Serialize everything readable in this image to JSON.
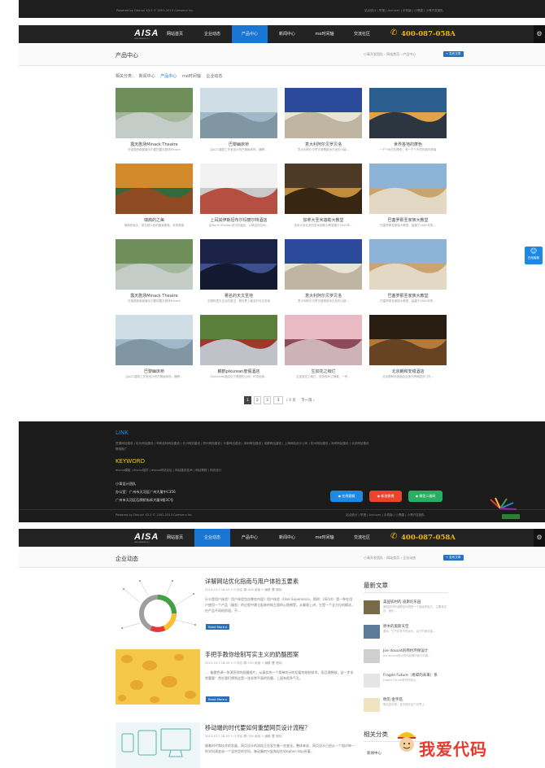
{
  "top_footer": {
    "copyright": "Powered by Discuz! X3.2 © 2001-2013 Comsenz Inc.",
    "links": "站点统计 | 举报 | Archiver | 手机版 | 小黑屋 | 小青开发团队"
  },
  "brand": {
    "logo": "AISA",
    "tagline": "www.aisacms.cn"
  },
  "nav": {
    "items": [
      "网站首页",
      "企业动态",
      "产品中心",
      "新闻中心",
      "me时间轴",
      "交流社区"
    ],
    "phone": "400-087-058A"
  },
  "products_page": {
    "title": "产品中心",
    "breadcrumb": "小青开发团队 › 网站首页 › 产品中心",
    "publish_button": "+ 发布文章",
    "categories_label": "相关分类：",
    "categories": [
      "新闻中心",
      "产品中心",
      "me时间轴",
      "企业动态"
    ],
    "active_category": "产品中心",
    "items": [
      {
        "title": "露天剧场Minack Theatre",
        "desc": "在英国西南部康沃尔郡的露天剧场Minack"
      },
      {
        "title": "巴黎幽床桥",
        "desc": "由AZC建筑工作室设计的巴黎幽床桥，横跨…"
      },
      {
        "title": "意大利阿尔贝罗贝洛",
        "desc": "意大利阿尔贝罗贝洛是欧洲古老的小镇…"
      },
      {
        "title": "世界各地的摩色",
        "desc": "一千个地方的摩色，有一千个不同的城市故事"
      },
      {
        "title": "瑞典的之美",
        "desc": "瑞典的秋天，被五颜六色的植被覆盖，非常美丽"
      },
      {
        "title": "上耳其伊斯坦布尔玛丽尔特酒店",
        "desc": "由Norm Shelton设计的酒店，以简洁的空间…"
      },
      {
        "title": "加拿大圣米迦勒大教堂",
        "desc": "加拿大多伦多的圣米迦勒大教堂建于1845年…"
      },
      {
        "title": "巴塞罗那圣家族大教堂",
        "desc": "巴塞罗那圣家族大教堂，始建于1882年的…"
      },
      {
        "title": "露天剧场Minack Theatre",
        "desc": "在英国西南部康沃尔郡的露天剧场Minack"
      },
      {
        "title": "著名的天文圣地",
        "desc": "中国阿里天文台的星空，是世界上著名的天文圣地"
      },
      {
        "title": "意大利阿尔贝罗贝洛",
        "desc": "意大利阿尔贝罗贝洛是欧洲古老的小镇…"
      },
      {
        "title": "巴塞罗那圣家族大教堂",
        "desc": "巴塞罗那圣家族大教堂，始建于1882年的…"
      },
      {
        "title": "巴黎幽床桥",
        "desc": "由AZC建筑工作室设计的巴黎幽床桥，横跨…"
      },
      {
        "title": "麟鹤pikurean度假酒店",
        "desc": "Epikurean酒店位于美丽的山间，环境优美…"
      },
      {
        "title": "生如花之绚烂",
        "desc": "生如夏花之绚烂，死如秋叶之静美，一杯…"
      },
      {
        "title": "北京朗和安缦酒店",
        "desc": "北京颐和安缦酒店坐落于颐和园东门外…"
      }
    ],
    "pagination": {
      "pages": [
        "1",
        "2",
        "3"
      ],
      "current": "1",
      "jump": "/ 3 页",
      "next": "下一页 ›"
    }
  },
  "footer": {
    "link_title": "LINK",
    "links_row1": "资源网站建设 | 包头网站建设 | 呼和浩特网站建设 | 长沙网站建设 | 郑州网站建设 | 长春网站建设 | 深圳网站建设 | 成都网站建设 | 上海网站设计公司 | 杭州网站建设 | 深圳网站建设 | 北京网站建设",
    "links_row2": "联络推广",
    "keyword_title": "KEYWORD",
    "keywords": "discuz模板 | discuz插件 | discuz网站论坛 | 网站建设技术 | 网站教程 | 网页设计",
    "team": "小青设计团队",
    "address1": "办公室：广州市天河区广州大厦中C356",
    "address2": "广州市天河区石牌桥街禾大厦4楼3C号",
    "online": "在线客服",
    "weibo": "新浪微博",
    "wechat": "微信二维码",
    "copyright": "Powered by Discuz! X3.2 © 2001-2013 Comsenz Inc.",
    "bottom_links": "站点统计 | 举报 | Archiver | 手机版 | 小黑屋 | 小青开发团队"
  },
  "news_page": {
    "title": "企业动态",
    "breadcrumb": "小青开发团队 › 网站首页 › 企业动态",
    "publish_button": "+ 发布文章",
    "articles": [
      {
        "title": "详解网站优化指南与用户体验五要素",
        "meta": "2013-10-7 18:33  ✎ 0 评论  👁 428 阅读  ✎ 编辑  🗑 删除",
        "excerpt": "什么是用户体验？用户体验包含哪些内容？用户体验（User Experience，简称：UE/UX）是一种在用户使用一个产品（服务）的过程中建立起来的纯主观的心理感受。从美观上讲，它是一个全方位的概念，在产品不同的阶段，不…",
        "more": "Read More ▸"
      },
      {
        "title": "手把手教你绘制写实主义的奶酪图案",
        "meta": "2013-10-7 18:33  ✎ 0 评论  👁 219 阅读  ✎ 编辑  🗑 删除",
        "excerpt": "…. 能跟色调一张漂亮到的奶酪图片，从真实的一个简单的计的切爱的绘制技术。而且理想效，这一步非常重要！首先我们想到这是一张非常平面的奶酪，上面有很多气孔。",
        "more": "Read More ▸"
      },
      {
        "title": "移动端的时代要如何重塑网页设计流程？",
        "meta": "2013-10-7 18:33  ✎ 0 评论  👁 239 阅读  ✎ 编辑  🗑 删除",
        "excerpt": "随着时代和技术的发展，网页设计的流程正在发生着一些变化。整体来说，网页设计已经从一个相对单一的学科演变成一个混合型的学科，移动端的兴起和现在Stephen Hay所著…",
        "more": "Read More ▸"
      }
    ],
    "sidebar": {
      "latest_title": "最新文章",
      "latest": [
        {
          "title": "美国农村的 迪斯尼乐园",
          "desc": "美国农村的迪斯尼乐园是一个遥远的地方，主要有生存、娱乐…"
        },
        {
          "title": "原木的奥斯天空",
          "desc": "原木，它千年来不的木头，由于时间流逝…"
        },
        {
          "title": "Joe doucet的简约环保设计",
          "desc": "Joe doucet设计的作品简约而又环保…"
        },
        {
          "title": "Fragile Future（易碎的未来）系",
          "desc": "Fragile Future系列作品以…"
        },
        {
          "title": "明见·金字塔",
          "desc": "明见金字塔，金字塔在这个世界上…"
        }
      ],
      "category_title": "相关分类",
      "category_first": "新闻中心"
    }
  },
  "float_qq": "在线客服",
  "watermark": "我爱代码"
}
